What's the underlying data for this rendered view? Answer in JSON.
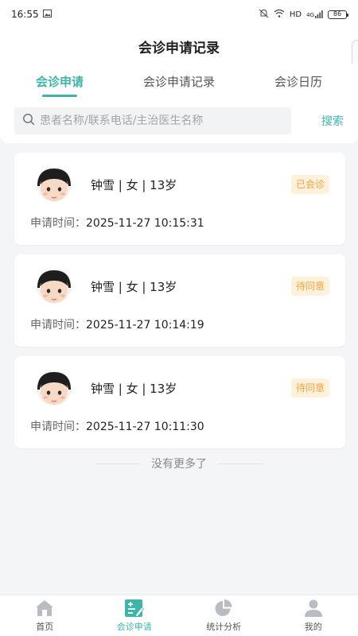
{
  "status_bar": {
    "time": "16:55",
    "network": "HD",
    "signal_label": "4G",
    "battery": "86"
  },
  "header": {
    "title": "会诊申请记录"
  },
  "tabs": [
    {
      "label": "会诊申请",
      "active": true
    },
    {
      "label": "会诊申请记录",
      "active": false
    },
    {
      "label": "会诊日历",
      "active": false
    }
  ],
  "search": {
    "placeholder": "患者名称/联系电话/主治医生名称",
    "button_label": "搜索"
  },
  "records": [
    {
      "patient": "钟雪 | 女 | 13岁",
      "status": "已会诊",
      "time_label": "申请时间：",
      "time": "2025-11-27 10:15:31"
    },
    {
      "patient": "钟雪 | 女 | 13岁",
      "status": "待同意",
      "time_label": "申请时间：",
      "time": "2025-11-27 10:14:19"
    },
    {
      "patient": "钟雪 | 女 | 13岁",
      "status": "待同意",
      "time_label": "申请时间：",
      "time": "2025-11-27 10:11:30"
    }
  ],
  "footer_text": "没有更多了",
  "bottom_nav": [
    {
      "label": "首页",
      "icon": "home-icon",
      "active": false
    },
    {
      "label": "会诊申请",
      "icon": "consult-apply-icon",
      "active": true
    },
    {
      "label": "统计分析",
      "icon": "pie-chart-icon",
      "active": false
    },
    {
      "label": "我的",
      "icon": "user-icon",
      "active": false
    }
  ],
  "colors": {
    "accent": "#3fb4a8",
    "badge_bg": "#fff1dc",
    "badge_text": "#f5a33a",
    "page_bg": "#f4f5f7"
  }
}
